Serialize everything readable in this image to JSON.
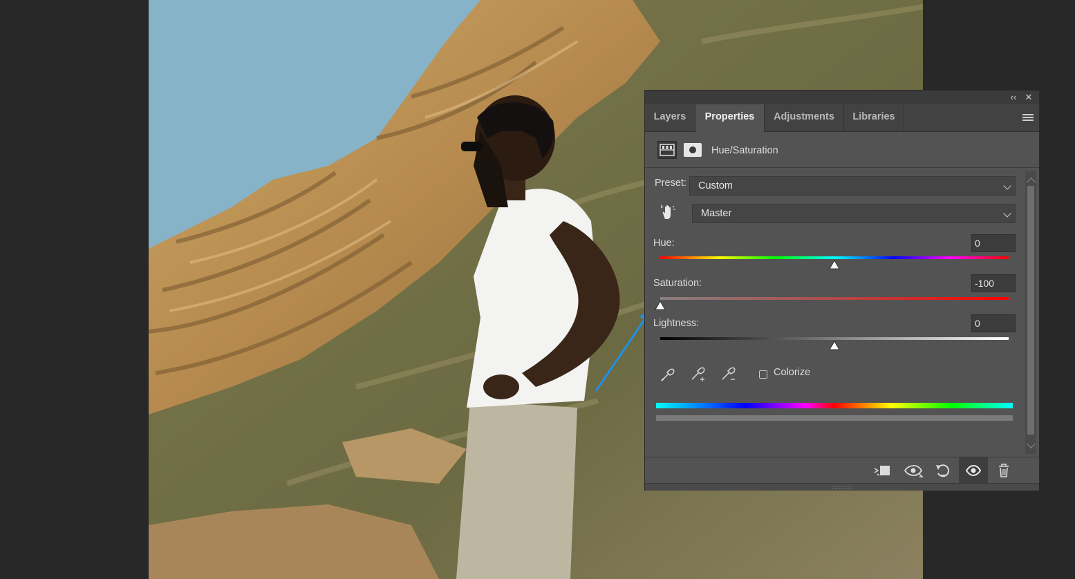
{
  "panel": {
    "tabs": [
      {
        "label": "Layers",
        "active": false
      },
      {
        "label": "Properties",
        "active": true
      },
      {
        "label": "Adjustments",
        "active": false
      },
      {
        "label": "Libraries",
        "active": false
      }
    ],
    "header": {
      "title": "Hue/Saturation"
    },
    "preset": {
      "label": "Preset:",
      "value": "Custom"
    },
    "channel": {
      "value": "Master"
    },
    "hue": {
      "label": "Hue:",
      "value": "0",
      "level": 0.5
    },
    "saturation": {
      "label": "Saturation:",
      "value": "-100",
      "level": 0.0
    },
    "lightness": {
      "label": "Lightness:",
      "value": "0",
      "level": 0.5
    },
    "colorize": {
      "label": "Colorize",
      "checked": false
    },
    "icons": {
      "collapse": "double-chevron-left-icon",
      "close": "close-icon",
      "menu": "hamburger-menu-icon"
    }
  },
  "colors": {
    "panel_bg": "#535353",
    "callout_arrow": "#1e90e6",
    "sky": "#86b3c7"
  }
}
